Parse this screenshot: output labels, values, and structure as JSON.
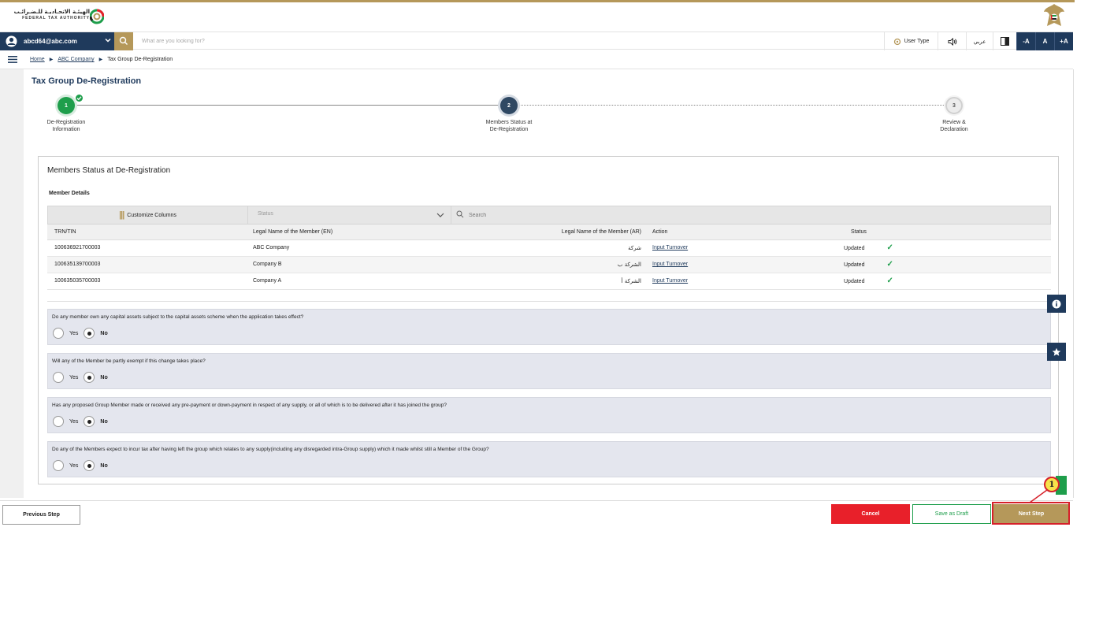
{
  "header": {
    "logo_ar": "الهيئـة الاتحـاديـة للـضـرائـب",
    "logo_en": "FEDERAL TAX AUTHORITY",
    "emblem_icon": "uae-emblem-icon"
  },
  "utilbar": {
    "user_email": "abcd64@abc.com",
    "search_placeholder": "What are you looking for?",
    "user_type": "User Type",
    "language": "عربي",
    "font_decrease": "-A",
    "font_normal": "A",
    "font_increase": "+A"
  },
  "breadcrumb": {
    "home": "Home",
    "company": "ABC Company",
    "current": "Tax Group De-Registration"
  },
  "page": {
    "title": "Tax Group De-Registration"
  },
  "stepper": {
    "steps": [
      {
        "number": "1",
        "label_line1": "De-Registration",
        "label_line2": "Information",
        "state": "completed"
      },
      {
        "number": "2",
        "label_line1": "Members Status at",
        "label_line2": "De-Registration",
        "state": "active"
      },
      {
        "number": "3",
        "label_line1": "Review &",
        "label_line2": "Declaration",
        "state": "pending"
      }
    ],
    "colors": {
      "completed": "#1e9e4b",
      "active": "#2f4863",
      "pending": "#e6e6e6"
    }
  },
  "card": {
    "title": "Members Status at De-Registration",
    "subtitle": "Member Details",
    "toolbar": {
      "customize_columns": "Customize Columns",
      "status_placeholder": "Status",
      "search_placeholder": "Search"
    },
    "columns": [
      "TRN/TIN",
      "Legal Name of the Member (EN)",
      "Legal Name of the Member (AR)",
      "Action",
      "Status"
    ],
    "rows": [
      {
        "trn": "100636921700003",
        "name_en": "ABC Company",
        "name_ar": "شركة",
        "action": "Input Turnover",
        "status": "Updated"
      },
      {
        "trn": "100635139700003",
        "name_en": "Company B",
        "name_ar": "الشركة ب",
        "action": "Input Turnover",
        "status": "Updated"
      },
      {
        "trn": "100635035700003",
        "name_en": "Company A",
        "name_ar": "الشركة أ",
        "action": "Input Turnover",
        "status": "Updated"
      }
    ]
  },
  "questions": [
    {
      "text": "Do any member own any capital assets subject to the capital assets scheme when the application takes effect?",
      "yes": "Yes",
      "no": "No",
      "selected": "No"
    },
    {
      "text": "Will any of the Member be partly exempt if this change takes place?",
      "yes": "Yes",
      "no": "No",
      "selected": "No"
    },
    {
      "text": "Has any proposed Group Member made or received any pre-payment or down-payment in respect of any supply, or all of which is to be delivered after it has joined the group?",
      "yes": "Yes",
      "no": "No",
      "selected": "No"
    },
    {
      "text": "Do any of the Members expect to incur tax after having left the group which relates to any supply(including any disregarded intra-Group supply) which it made whilst still a Member of the Group?",
      "yes": "Yes",
      "no": "No",
      "selected": "No"
    }
  ],
  "footer": {
    "previous": "Previous Step",
    "cancel": "Cancel",
    "save_draft": "Save as Draft",
    "next": "Next Step"
  },
  "annotation": {
    "callout_number": "1"
  },
  "colors": {
    "navy": "#1f3a5c",
    "gold": "#b5985a",
    "green": "#1e9e4b",
    "red": "#e8202a"
  }
}
